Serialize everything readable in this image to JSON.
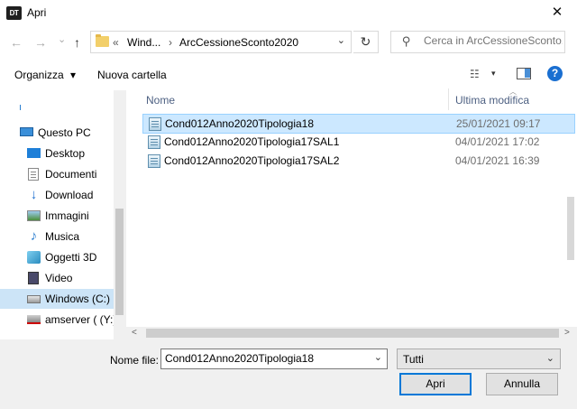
{
  "window": {
    "app_icon_text": "DT",
    "title": "Apri",
    "close_glyph": "✕"
  },
  "navigation": {
    "back_glyph": "←",
    "forward_glyph": "→",
    "recent_glyph": "⌄",
    "up_glyph": "↑",
    "address": {
      "overflow": "«",
      "segment_1": "Wind...",
      "separator": "›",
      "segment_2": "ArcCessioneSconto2020",
      "chevron": "⌄"
    },
    "refresh_glyph": "↻",
    "search_icon_glyph": "⚲",
    "search_placeholder": "Cerca in ArcCessioneSconto..."
  },
  "toolbar": {
    "organize_label": "Organizza",
    "organize_chevron": "▾",
    "new_folder_label": "Nuova cartella",
    "view_glyph": "☷",
    "view_chevron": "▾",
    "help_glyph": "?"
  },
  "sidebar": {
    "items": [
      {
        "label": "Questo PC",
        "icon": "computer-icon"
      },
      {
        "label": "Desktop",
        "icon": "desktop-icon"
      },
      {
        "label": "Documenti",
        "icon": "documents-icon"
      },
      {
        "label": "Download",
        "icon": "download-icon"
      },
      {
        "label": "Immagini",
        "icon": "pictures-icon"
      },
      {
        "label": "Musica",
        "icon": "music-icon"
      },
      {
        "label": "Oggetti 3D",
        "icon": "objects-3d-icon"
      },
      {
        "label": "Video",
        "icon": "video-icon"
      },
      {
        "label": "Windows (C:)",
        "icon": "drive-icon",
        "selected": true
      },
      {
        "label": "amserver ( (Y:)",
        "icon": "network-drive-icon"
      }
    ],
    "download_glyph": "↓",
    "music_glyph": "♪"
  },
  "file_list": {
    "columns": {
      "name": "Nome",
      "modified": "Ultima modifica"
    },
    "sort_glyph": "︿",
    "rows": [
      {
        "name": "Cond012Anno2020Tipologia18",
        "modified": "25/01/2021 09:17",
        "selected": true
      },
      {
        "name": "Cond012Anno2020Tipologia17SAL1",
        "modified": "04/01/2021 17:02"
      },
      {
        "name": "Cond012Anno2020Tipologia17SAL2",
        "modified": "04/01/2021 16:39"
      }
    ]
  },
  "scrollbar": {
    "left_glyph": "<",
    "right_glyph": ">"
  },
  "footer": {
    "file_name_label": "Nome file:",
    "file_name_value": "Cond012Anno2020Tipologia18",
    "file_name_chevron": "⌄",
    "file_type_value": "Tutti",
    "file_type_chevron": "⌄",
    "open_label": "Apri",
    "cancel_label": "Annulla"
  },
  "colors": {
    "accent": "#0078d7",
    "selection": "#cce8ff",
    "help_blue": "#1a6fd1"
  }
}
